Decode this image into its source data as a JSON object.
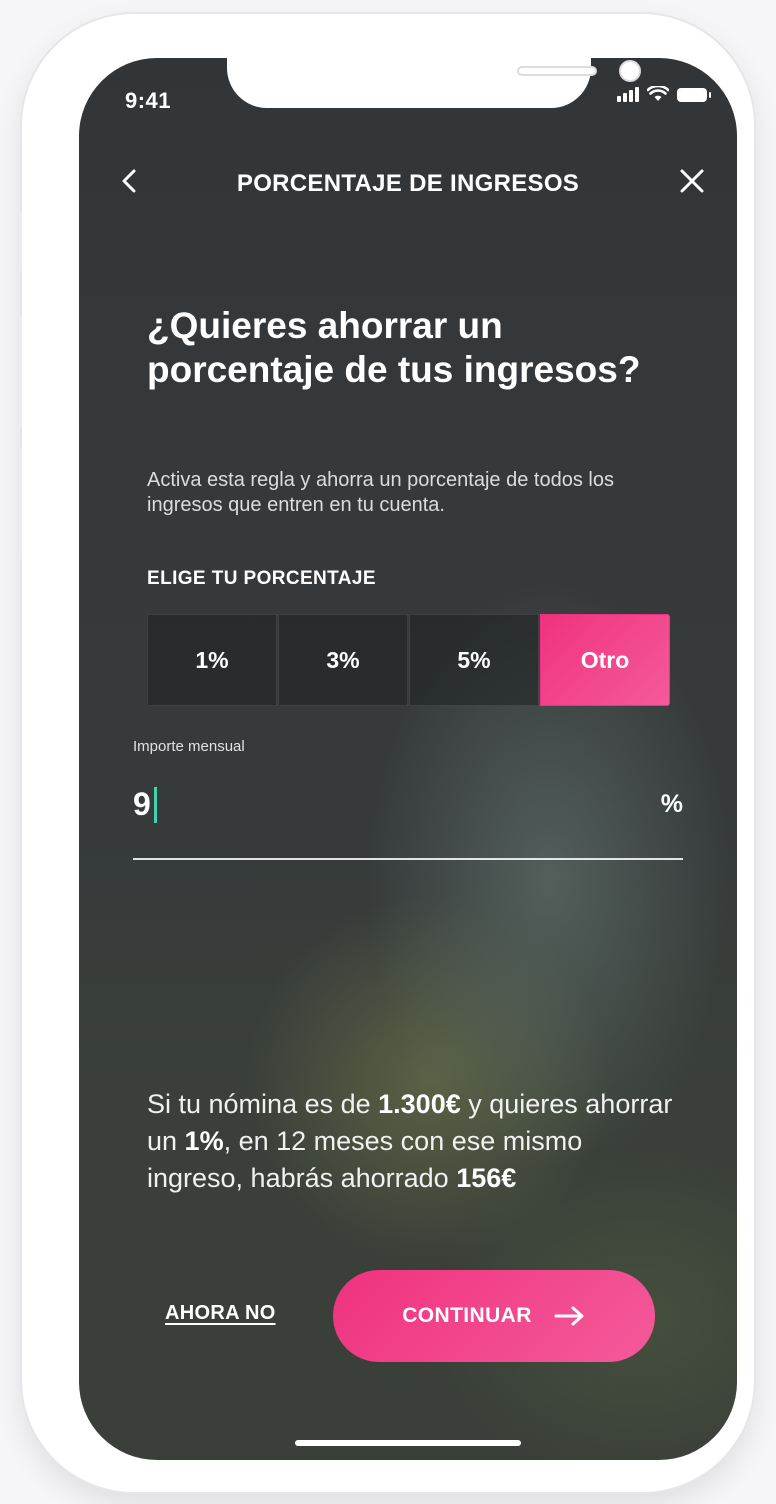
{
  "status_bar": {
    "time": "9:41"
  },
  "header": {
    "title": "PORCENTAJE DE INGRESOS",
    "back_icon": "chevron-left-icon",
    "close_icon": "close-icon"
  },
  "main": {
    "headline": "¿Quieres ahorrar un porcentaje de tus ingresos?",
    "subtitle": "Activa esta regla y ahorra un porcentaje de todos los ingresos que entren en tu cuenta.",
    "section_label": "ELIGE TU PORCENTAJE",
    "options": [
      {
        "label": "1%",
        "selected": false
      },
      {
        "label": "3%",
        "selected": false
      },
      {
        "label": "5%",
        "selected": false
      },
      {
        "label": "Otro",
        "selected": true
      }
    ],
    "amount_field": {
      "label": "Importe mensual",
      "value": "9",
      "suffix": "%"
    },
    "info": {
      "part1": "Si tu nómina es de ",
      "salary": "1.300€",
      "part2": " y quieres ahorrar un ",
      "percent": "1%",
      "part3": ", en 12 meses con ese mismo ingreso, habrás ahorrado ",
      "saved": "156€"
    }
  },
  "footer": {
    "skip_label": "AHORA NO",
    "continue_label": "CONTINUAR",
    "continue_icon": "arrow-right-icon"
  },
  "colors": {
    "accent": "#f0327e",
    "caret": "#3fd3b0",
    "background": "#343739"
  }
}
